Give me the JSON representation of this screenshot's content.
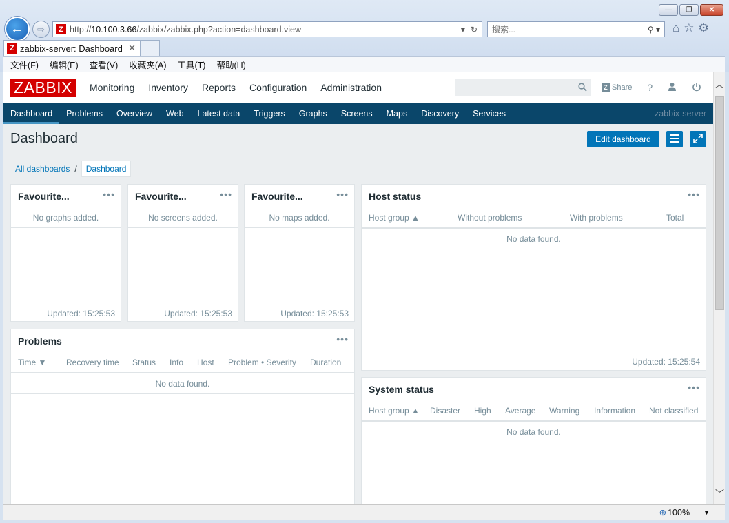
{
  "browser": {
    "url_prefix": "http://",
    "url_host": "10.100.3.66",
    "url_path": "/zabbix/zabbix.php?action=dashboard.view",
    "search_placeholder": "搜索...",
    "tab_title": "zabbix-server: Dashboard",
    "menu": [
      "文件(F)",
      "编辑(E)",
      "查看(V)",
      "收藏夹(A)",
      "工具(T)",
      "帮助(H)"
    ],
    "zoom": "100%"
  },
  "zabbix": {
    "logo": "ZABBIX",
    "main_menu": [
      "Monitoring",
      "Inventory",
      "Reports",
      "Configuration",
      "Administration"
    ],
    "share_label": "Share",
    "help_label": "?",
    "sub_menu": [
      "Dashboard",
      "Problems",
      "Overview",
      "Web",
      "Latest data",
      "Triggers",
      "Graphs",
      "Screens",
      "Maps",
      "Discovery",
      "Services"
    ],
    "server_name": "zabbix-server",
    "page_title": "Dashboard",
    "edit_button": "Edit dashboard",
    "breadcrumb": {
      "all": "All dashboards",
      "sep": "/",
      "current": "Dashboard"
    }
  },
  "widgets": {
    "fav_graphs": {
      "title": "Favourite...",
      "empty": "No graphs added.",
      "updated": "Updated: 15:25:53"
    },
    "fav_screens": {
      "title": "Favourite...",
      "empty": "No screens added.",
      "updated": "Updated: 15:25:53"
    },
    "fav_maps": {
      "title": "Favourite...",
      "empty": "No maps added.",
      "updated": "Updated: 15:25:53"
    },
    "host_status": {
      "title": "Host status",
      "columns": [
        "Host group ▲",
        "Without problems",
        "With problems",
        "Total"
      ],
      "empty": "No data found.",
      "updated": "Updated: 15:25:54"
    },
    "problems": {
      "title": "Problems",
      "columns": [
        "Time ▼",
        "Recovery time",
        "Status",
        "Info",
        "Host",
        "Problem • Severity",
        "Duration"
      ],
      "empty": "No data found."
    },
    "system_status": {
      "title": "System status",
      "columns": [
        "Host group ▲",
        "Disaster",
        "High",
        "Average",
        "Warning",
        "Information",
        "Not classified"
      ],
      "empty": "No data found."
    },
    "menu_dots": "•••"
  },
  "colors": {
    "brand_red": "#d40000",
    "nav_blue": "#0a466a",
    "button_blue": "#0275b8"
  }
}
